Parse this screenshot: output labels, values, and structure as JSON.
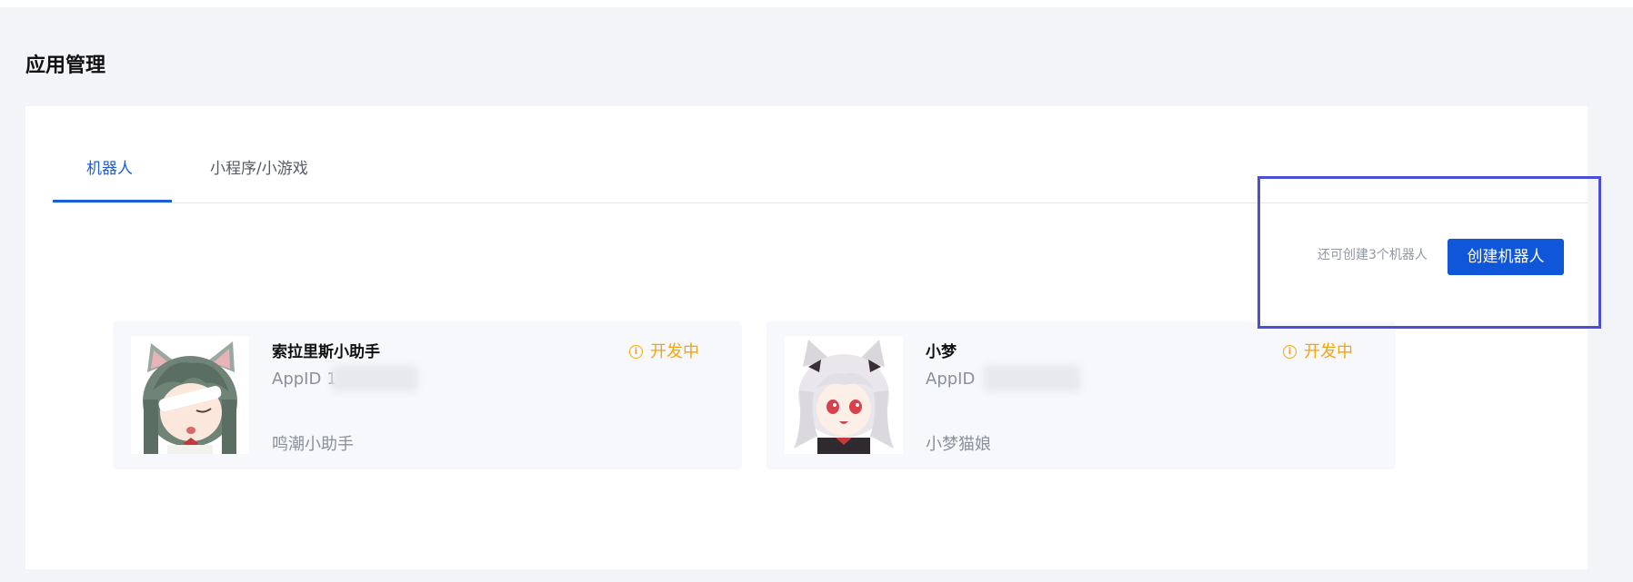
{
  "page": {
    "title": "应用管理"
  },
  "tabs": [
    {
      "label": "机器人",
      "active": true
    },
    {
      "label": "小程序/小游戏",
      "active": false
    }
  ],
  "toolbar": {
    "quota_text": "还可创建3个机器人",
    "create_label": "创建机器人"
  },
  "bots": [
    {
      "name": "索拉里斯小助手",
      "appid_label": "AppID",
      "appid_value": "1",
      "status": "开发中",
      "description": "鸣潮小助手",
      "avatar": "cat-ear-girl-avatar"
    },
    {
      "name": "小梦",
      "appid_label": "AppID",
      "appid_value": "",
      "status": "开发中",
      "description": "小梦猫娘",
      "avatar": "white-hair-catgirl-avatar"
    }
  ],
  "colors": {
    "accent": "#1c5fd6",
    "button": "#0f56d9",
    "status": "#f5a50a",
    "highlight": "#4a4fd6"
  },
  "icons": {
    "status_icon": "info-circle-icon"
  }
}
